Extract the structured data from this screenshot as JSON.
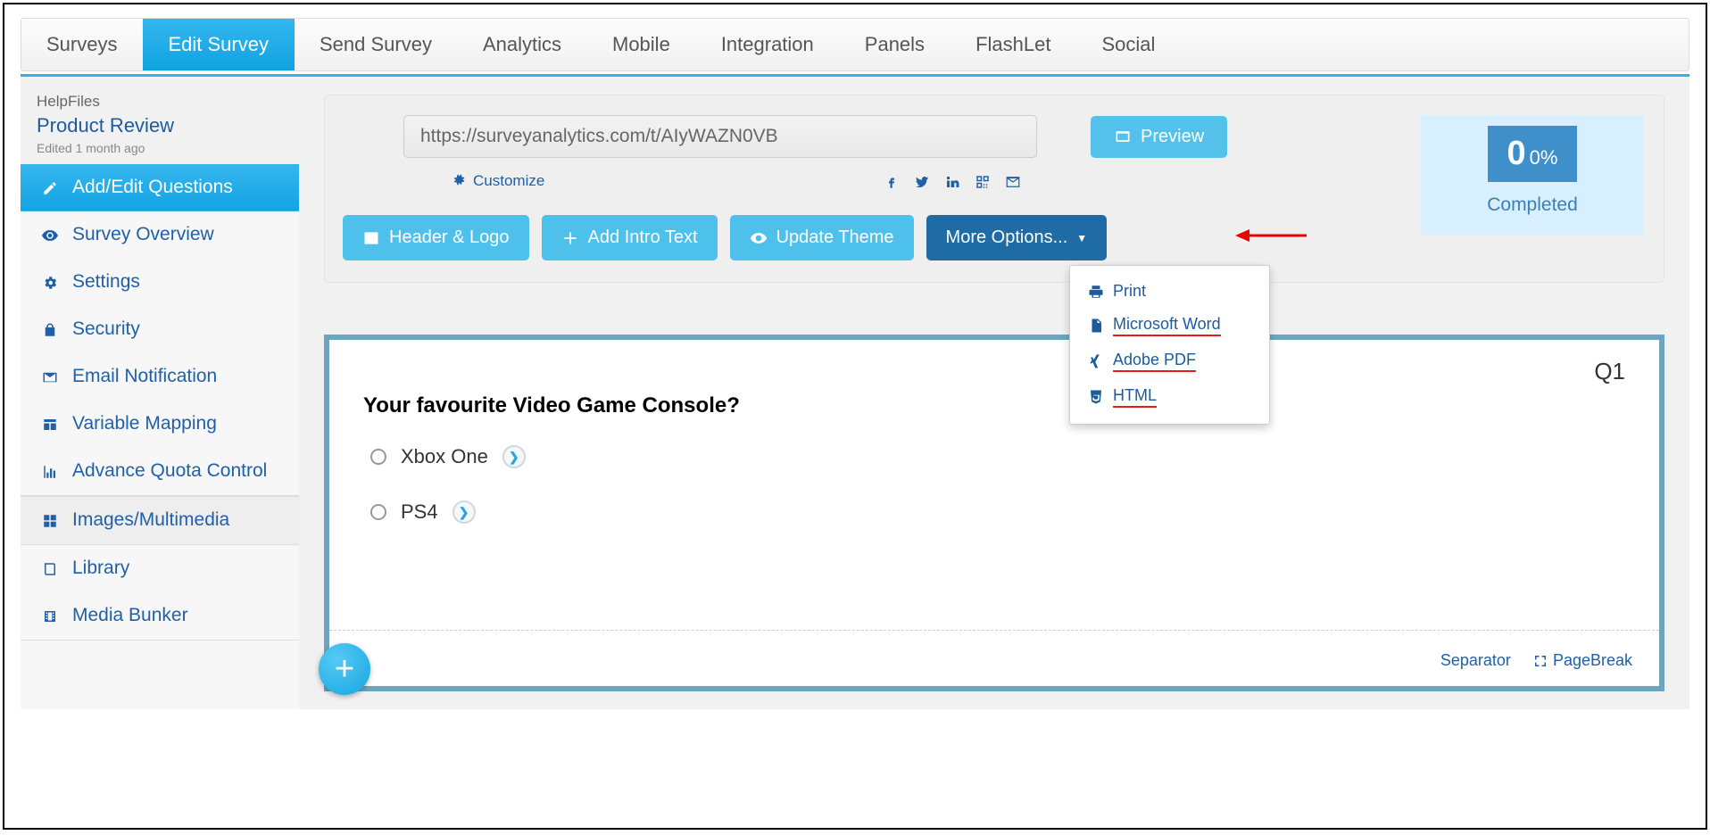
{
  "topnav": {
    "tabs": [
      "Surveys",
      "Edit Survey",
      "Send Survey",
      "Analytics",
      "Mobile",
      "Integration",
      "Panels",
      "FlashLet",
      "Social"
    ],
    "active": 1
  },
  "sidebar": {
    "breadcrumb": "HelpFiles",
    "title": "Product Review",
    "edited": "Edited 1 month ago",
    "items": [
      {
        "label": "Add/Edit Questions"
      },
      {
        "label": "Survey Overview"
      },
      {
        "label": "Settings"
      },
      {
        "label": "Security"
      },
      {
        "label": "Email Notification"
      },
      {
        "label": "Variable Mapping"
      },
      {
        "label": "Advance Quota Control"
      },
      {
        "label": "Images/Multimedia"
      },
      {
        "label": "Library"
      },
      {
        "label": "Media Bunker"
      }
    ]
  },
  "panel": {
    "url": "https://surveyanalytics.com/t/AIyWAZN0VB",
    "preview": "Preview",
    "customize": "Customize",
    "toolbar": {
      "header_logo": "Header & Logo",
      "intro_text": "Add Intro Text",
      "update_theme": "Update Theme",
      "more_options": "More Options..."
    },
    "completed": {
      "count": "0",
      "percent": "0%",
      "label": "Completed"
    },
    "dropdown": {
      "print": "Print",
      "word": "Microsoft Word",
      "pdf": "Adobe PDF",
      "html": "HTML"
    }
  },
  "question": {
    "number": "Q1",
    "text": "Your favourite Video Game Console?",
    "options": [
      "Xbox One",
      "PS4"
    ],
    "footer": {
      "separator": "Separator",
      "pagebreak": "PageBreak"
    }
  }
}
